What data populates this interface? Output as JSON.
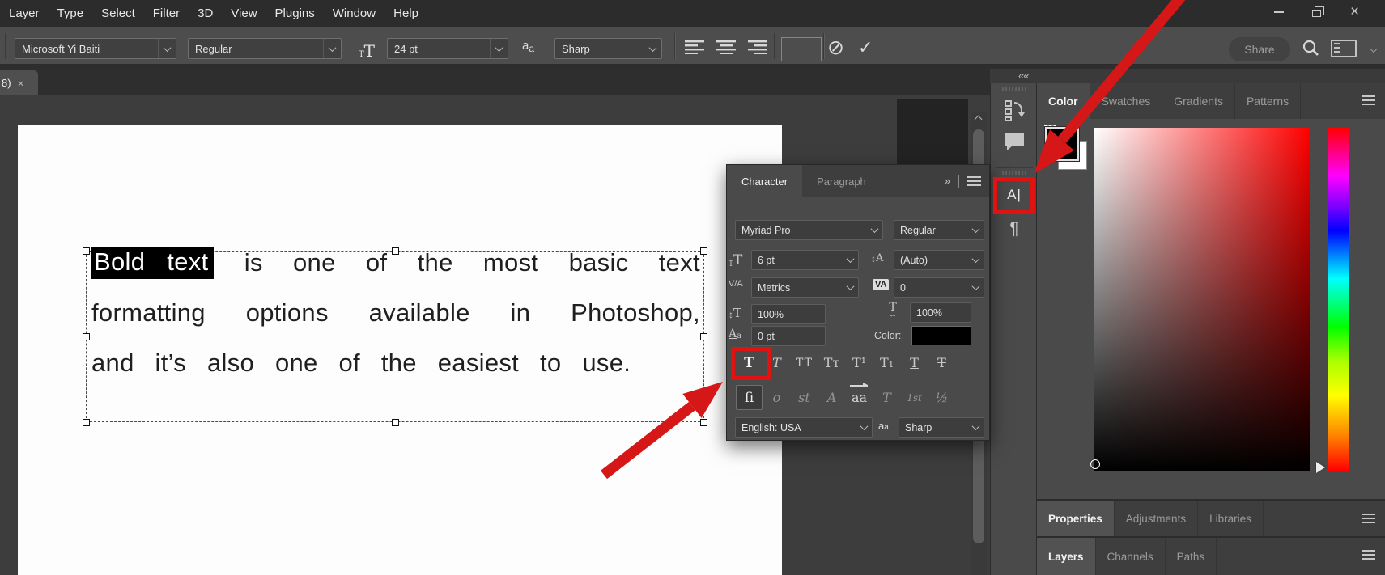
{
  "menu_bar": {
    "items": [
      "Layer",
      "Type",
      "Select",
      "Filter",
      "3D",
      "View",
      "Plugins",
      "Window",
      "Help"
    ]
  },
  "window_controls": {
    "close_glyph": "×"
  },
  "options_bar": {
    "font_family": "Microsoft Yi Baiti",
    "font_style": "Regular",
    "size_icon_small": "T",
    "size_icon_big": "T",
    "font_size": "24 pt",
    "anti_alias_icon_a1": "a",
    "anti_alias_icon_a2": "a",
    "anti_alias": "Sharp",
    "text_color": "#000000",
    "cancel_glyph": "⊘",
    "commit_glyph": "✓",
    "share_label": "Share"
  },
  "document_tab": {
    "label": "8)",
    "close_glyph": "×"
  },
  "canvas": {
    "highlight_words": [
      "Bold",
      "text"
    ],
    "line1_words": [
      "is",
      "one",
      "of",
      "the",
      "most",
      "basic",
      "text"
    ],
    "line2_words": [
      "formatting",
      "options",
      "available",
      "in",
      "Photoshop,"
    ],
    "line3_text": "and it’s also one of the easiest to use."
  },
  "character_panel": {
    "tab_character": "Character",
    "tab_paragraph": "Paragraph",
    "panel_menu_glyph": "»",
    "font_family": "Myriad Pro",
    "font_style": "Regular",
    "font_size": "6 pt",
    "leading": "(Auto)",
    "kerning": "Metrics",
    "tracking": "0",
    "vertical_scale": "100%",
    "horizontal_scale": "100%",
    "baseline_shift": "0 pt",
    "color_label": "Color:",
    "color_value": "#000000",
    "icons": {
      "size_small": "T",
      "size_big": "T",
      "leading_arrow": "↕",
      "leading_letter": "A",
      "kerning": "V/A",
      "tracking": "VA",
      "vscale_arrow": "↕",
      "vscale_letter": "T",
      "hscale_letter": "T",
      "hscale_arrow": "↔",
      "baseline_big": "A",
      "baseline_small": "a"
    },
    "format_buttons": {
      "faux_bold": "T",
      "faux_italic": "T",
      "all_caps": "TT",
      "small_caps": "Tᴛ",
      "superscript": "T¹",
      "subscript": "T₁",
      "underline": "T",
      "strikethrough": "T"
    },
    "opentype_buttons": {
      "ligatures": "fi",
      "swash": "o",
      "discretionary_ligatures": "st",
      "stylistic_alternates": "A",
      "contextual_alternates": "aa",
      "titling_alternates": "T",
      "ordinals": "1st",
      "fractions": "½"
    },
    "language": "English: USA",
    "anti_alias_icon_a1": "a",
    "anti_alias_icon_a2": "a",
    "anti_alias": "Sharp"
  },
  "dock": {
    "collapse_glyph": "««",
    "character_icon": "A|",
    "paragraph_icon": "¶"
  },
  "color_panel": {
    "tabs": [
      "Color",
      "Swatches",
      "Gradients",
      "Patterns"
    ],
    "foreground_color": "#000000",
    "background_color": "#ffffff"
  },
  "properties_panel": {
    "tabs": [
      "Properties",
      "Adjustments",
      "Libraries"
    ]
  },
  "layers_panel": {
    "tabs": [
      "Layers",
      "Channels",
      "Paths"
    ]
  },
  "annotations": {
    "arrow_color": "#d61717",
    "box_color": "#e01313"
  }
}
